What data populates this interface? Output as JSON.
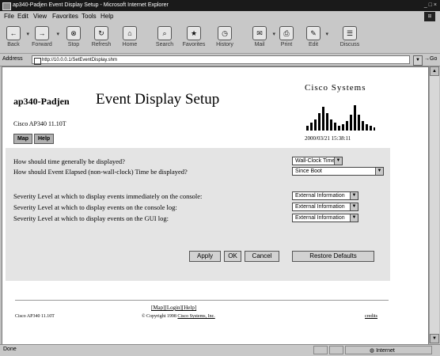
{
  "window": {
    "title": "ap340-Padjen Event Display Setup - Microsoft Internet Explorer",
    "controls": "_ □ ×"
  },
  "menu": {
    "items": [
      "File",
      "Edit",
      "View",
      "Favorites",
      "Tools",
      "Help"
    ]
  },
  "toolbar": {
    "buttons": [
      {
        "label": "Back",
        "icon": "back-arrow-icon",
        "glyph": "←"
      },
      {
        "label": "Forward",
        "icon": "forward-arrow-icon",
        "glyph": "→"
      },
      {
        "label": "Stop",
        "icon": "stop-icon",
        "glyph": "⊗"
      },
      {
        "label": "Refresh",
        "icon": "refresh-icon",
        "glyph": "↻"
      },
      {
        "label": "Home",
        "icon": "home-icon",
        "glyph": "⌂"
      },
      {
        "label": "Search",
        "icon": "search-icon",
        "glyph": "⌕"
      },
      {
        "label": "Favorites",
        "icon": "favorites-icon",
        "glyph": "★"
      },
      {
        "label": "History",
        "icon": "history-icon",
        "glyph": "◷"
      },
      {
        "label": "Mail",
        "icon": "mail-icon",
        "glyph": "✉"
      },
      {
        "label": "Print",
        "icon": "print-icon",
        "glyph": "⎙"
      },
      {
        "label": "Edit",
        "icon": "edit-icon",
        "glyph": "✎"
      },
      {
        "label": "Discuss",
        "icon": "discuss-icon",
        "glyph": "☰"
      }
    ]
  },
  "address": {
    "label": "Address",
    "url": "http://10.0.0.1/SetEventDisplay.shm",
    "go": "Go"
  },
  "page": {
    "device_name": "ap340-Padjen",
    "title": "Event Display Setup",
    "model_line": "Cisco AP340 11.10T",
    "nav_buttons": [
      "Map",
      "Help"
    ],
    "brand": "Cisco Systems",
    "timestamp": "2000/03/21 15:38:11",
    "questions": [
      {
        "text": "How should time generally be displayed?",
        "selected": "Wall-Clock Time"
      },
      {
        "text": "How should Event Elapsed (non-wall-clock) Time be displayed?",
        "selected": "Since Boot"
      },
      {
        "text": "Severity Level at which to display events immediately on the console:",
        "selected": "External Information"
      },
      {
        "text": "Severity Level at which to display events on the console log:",
        "selected": "External Information"
      },
      {
        "text": "Severity Level at which to display events on the GUI log:",
        "selected": "External Information"
      }
    ],
    "buttons": {
      "apply": "Apply",
      "ok": "OK",
      "cancel": "Cancel",
      "restore": "Restore Defaults"
    },
    "footer": {
      "links": "[Map][Login][Help]",
      "left": "Cisco AP340 11.10T",
      "copyright_prefix": "© Copyright 1998 ",
      "copyright_link": "Cisco Systems, Inc.",
      "right": "credits"
    }
  },
  "status": {
    "text": "Done",
    "zone": "Internet"
  }
}
